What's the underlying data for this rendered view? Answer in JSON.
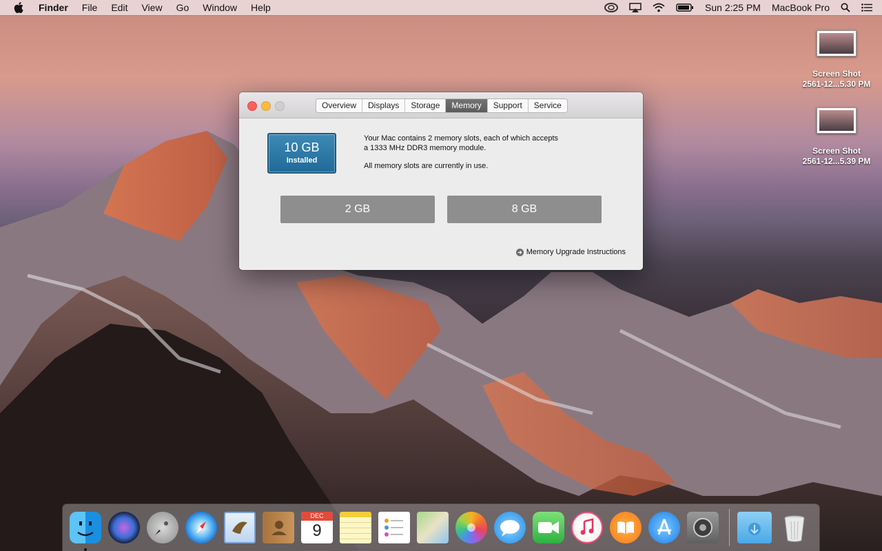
{
  "menubar": {
    "apple": "",
    "app_name": "Finder",
    "menus": [
      "File",
      "Edit",
      "View",
      "Go",
      "Window",
      "Help"
    ],
    "clock": "Sun 2:25 PM",
    "computer_name": "MacBook Pro"
  },
  "desktop_icons": [
    {
      "name_line1": "Screen Shot",
      "name_line2": "2561-12...5.30 PM"
    },
    {
      "name_line1": "Screen Shot",
      "name_line2": "2561-12...5.39 PM"
    }
  ],
  "window": {
    "tabs": [
      "Overview",
      "Displays",
      "Storage",
      "Memory",
      "Support",
      "Service"
    ],
    "active_tab": "Memory",
    "installed_size": "10 GB",
    "installed_label": "Installed",
    "info_line1": "Your Mac contains 2 memory slots, each of which accepts",
    "info_line2": "a 1333 MHz DDR3 memory module.",
    "info_line3": "All memory slots are currently in use.",
    "slots": [
      "2 GB",
      "8 GB"
    ],
    "upgrade_link": "Memory Upgrade Instructions"
  },
  "dock": {
    "apps": [
      "finder-icon",
      "siri-icon",
      "launchpad-icon",
      "safari-icon",
      "mail-icon",
      "contacts-icon",
      "calendar-icon",
      "notes-icon",
      "reminders-icon",
      "maps-icon",
      "photos-icon",
      "messages-icon",
      "facetime-icon",
      "itunes-icon",
      "ibooks-icon",
      "app-store-icon",
      "system-preferences-icon"
    ],
    "calendar_month": "DEC",
    "calendar_day": "9",
    "others": [
      "downloads-folder-icon",
      "trash-icon"
    ]
  },
  "colors": {
    "accent_blue": "#2a78a8",
    "slot_gray": "#8e8e8e",
    "close": "#fc605c",
    "minimize": "#fdbc40"
  }
}
